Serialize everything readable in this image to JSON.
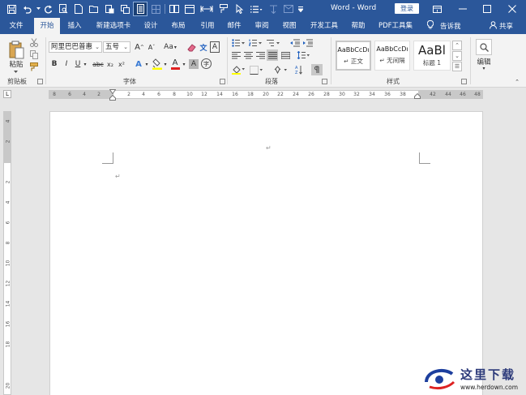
{
  "title_bar": {
    "window_title": "Word - Word",
    "login_label": "登录"
  },
  "tabs": [
    {
      "label": "文件",
      "active": false
    },
    {
      "label": "开始",
      "active": true
    },
    {
      "label": "插入",
      "active": false
    },
    {
      "label": "新建选项卡",
      "active": false
    },
    {
      "label": "设计",
      "active": false
    },
    {
      "label": "布局",
      "active": false
    },
    {
      "label": "引用",
      "active": false
    },
    {
      "label": "邮件",
      "active": false
    },
    {
      "label": "审阅",
      "active": false
    },
    {
      "label": "视图",
      "active": false
    },
    {
      "label": "开发工具",
      "active": false
    },
    {
      "label": "帮助",
      "active": false
    },
    {
      "label": "PDF工具集",
      "active": false
    }
  ],
  "tell_me": "告诉我",
  "share": "共享",
  "ribbon": {
    "clipboard": {
      "paste_label": "粘贴",
      "group_label": "剪贴板"
    },
    "font": {
      "font_name": "阿里巴巴普惠",
      "font_size": "五号",
      "grow_label": "A",
      "shrink_label": "A",
      "case_label": "Aa",
      "clear_label": "A",
      "bold": "B",
      "italic": "I",
      "underline": "U",
      "strike": "abc",
      "subscript": "x₂",
      "superscript": "x²",
      "text_effect": "A",
      "font_color": "A",
      "char_shading": "A",
      "enclose": "字",
      "group_label": "字体"
    },
    "paragraph": {
      "group_label": "段落"
    },
    "styles": {
      "items": [
        {
          "sample": "AaBbCcDı",
          "name": "↵ 正文"
        },
        {
          "sample": "AaBbCcDı",
          "name": "↵ 无间隔"
        },
        {
          "sample": "AaBl",
          "name": "标题 1"
        }
      ],
      "group_label": "样式"
    },
    "editing": {
      "label": "编辑"
    }
  },
  "ruler": {
    "tab_selector": "L",
    "numbers": [
      "8",
      "6",
      "4",
      "2",
      "2",
      "4",
      "6",
      "8",
      "10",
      "12",
      "14",
      "16",
      "18",
      "20",
      "22",
      "24",
      "26",
      "28",
      "30",
      "32",
      "34",
      "36",
      "38",
      "42",
      "44",
      "46",
      "48"
    ],
    "vertical_numbers": [
      "4",
      "2",
      "2",
      "4",
      "6",
      "8",
      "10",
      "12",
      "14",
      "16",
      "18",
      "20"
    ]
  },
  "document": {
    "para_mark": "↵"
  },
  "watermark": {
    "title": "这里下载",
    "url": "www.herdown.com"
  },
  "colors": {
    "title_bar": "#2b579a",
    "ribbon": "#f3f3f3",
    "font_color_red": "#e02020",
    "highlight_yellow": "#ffff00"
  }
}
